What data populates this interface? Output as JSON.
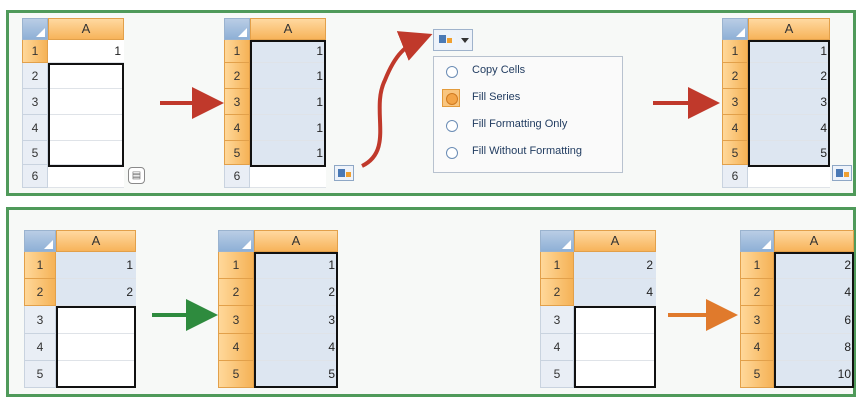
{
  "column_header": "A",
  "top_row": {
    "step1": {
      "rows": [
        {
          "row": "1",
          "value": "1"
        },
        {
          "row": "2",
          "value": ""
        },
        {
          "row": "3",
          "value": ""
        },
        {
          "row": "4",
          "value": ""
        },
        {
          "row": "5",
          "value": ""
        },
        {
          "row": "6",
          "value": ""
        }
      ]
    },
    "step2": {
      "rows": [
        {
          "row": "1",
          "value": "1"
        },
        {
          "row": "2",
          "value": "1"
        },
        {
          "row": "3",
          "value": "1"
        },
        {
          "row": "4",
          "value": "1"
        },
        {
          "row": "5",
          "value": "1"
        },
        {
          "row": "6",
          "value": ""
        }
      ]
    },
    "menu": {
      "items": [
        {
          "label": "Copy Cells",
          "checked": false
        },
        {
          "label": "Fill Series",
          "checked": true
        },
        {
          "label": "Fill Formatting Only",
          "checked": false
        },
        {
          "label": "Fill Without Formatting",
          "checked": false
        }
      ]
    },
    "step4": {
      "rows": [
        {
          "row": "1",
          "value": "1"
        },
        {
          "row": "2",
          "value": "2"
        },
        {
          "row": "3",
          "value": "3"
        },
        {
          "row": "4",
          "value": "4"
        },
        {
          "row": "5",
          "value": "5"
        },
        {
          "row": "6",
          "value": ""
        }
      ]
    }
  },
  "bottom_row": {
    "ex1_before": {
      "rows": [
        {
          "row": "1",
          "value": "1"
        },
        {
          "row": "2",
          "value": "2"
        },
        {
          "row": "3",
          "value": ""
        },
        {
          "row": "4",
          "value": ""
        },
        {
          "row": "5",
          "value": ""
        }
      ]
    },
    "ex1_after": {
      "rows": [
        {
          "row": "1",
          "value": "1"
        },
        {
          "row": "2",
          "value": "2"
        },
        {
          "row": "3",
          "value": "3"
        },
        {
          "row": "4",
          "value": "4"
        },
        {
          "row": "5",
          "value": "5"
        }
      ]
    },
    "ex2_before": {
      "rows": [
        {
          "row": "1",
          "value": "2"
        },
        {
          "row": "2",
          "value": "4"
        },
        {
          "row": "3",
          "value": ""
        },
        {
          "row": "4",
          "value": ""
        },
        {
          "row": "5",
          "value": ""
        }
      ]
    },
    "ex2_after": {
      "rows": [
        {
          "row": "1",
          "value": "2"
        },
        {
          "row": "2",
          "value": "4"
        },
        {
          "row": "3",
          "value": "6"
        },
        {
          "row": "4",
          "value": "8"
        },
        {
          "row": "5",
          "value": "10"
        }
      ]
    }
  },
  "colors": {
    "panel_border": "#4f9a5a",
    "arrow_red": "#c0392b",
    "arrow_green": "#2e8b3e",
    "arrow_orange": "#e07a2c",
    "header_orange": "#f7b35a",
    "selection_fill": "#dde6f1"
  },
  "icons": {
    "autofill_options": "autofill-options-icon",
    "dropdown": "chevron-down-icon"
  }
}
